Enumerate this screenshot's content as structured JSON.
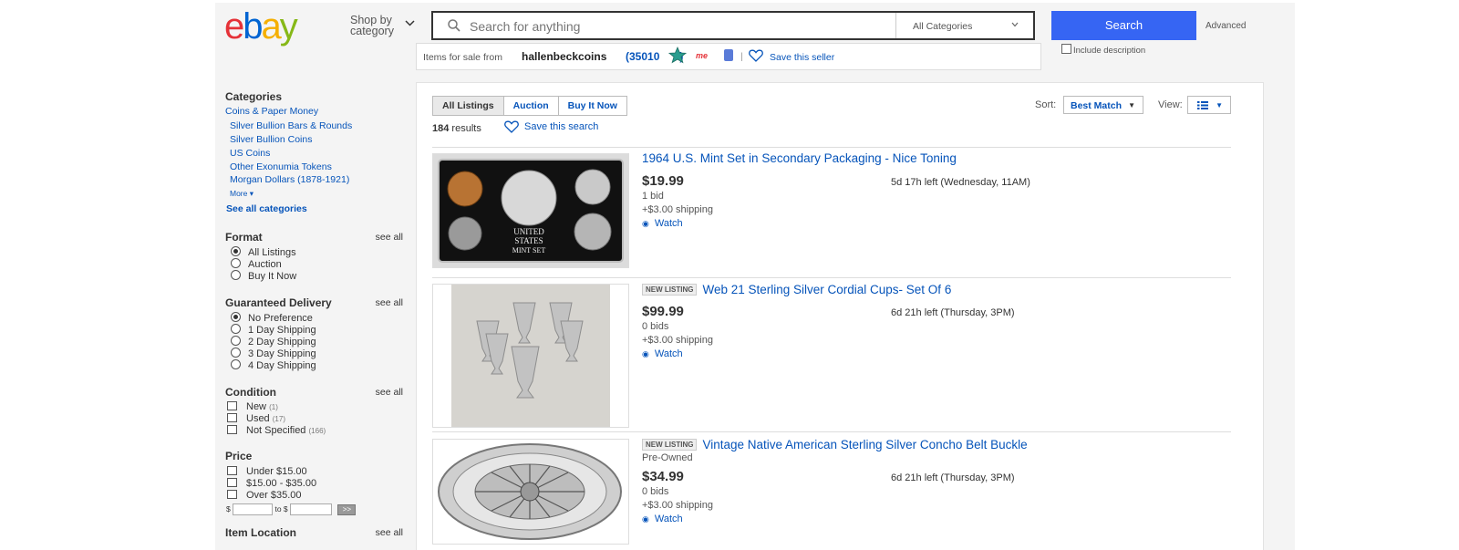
{
  "header": {
    "logo_letters": [
      "e",
      "b",
      "a",
      "y"
    ],
    "shop_by_line1": "Shop by",
    "shop_by_line2": "category",
    "search_placeholder": "Search for anything",
    "category_select": "All Categories",
    "search_button": "Search",
    "advanced_link": "Advanced",
    "include_description": "Include description",
    "brand_colors": {
      "e": "#e53238",
      "b": "#0064d2",
      "a": "#f5af02",
      "y": "#86b817"
    }
  },
  "seller": {
    "prefix": "Items for sale from",
    "name": "hallenbeckcoins",
    "feedback_open": "(",
    "feedback": "35010",
    "feedback_close": ")",
    "me_badge": "me",
    "separator": "|",
    "save_label": "Save this seller"
  },
  "sidebar": {
    "categories_title": "Categories",
    "top_category": "Coins & Paper Money",
    "subcategories": [
      "Silver Bullion Bars & Rounds",
      "Silver Bullion Coins",
      "US Coins",
      "Other Exonumia Tokens",
      "Morgan Dollars (1878-1921)"
    ],
    "more": "More",
    "see_all_categories": "See all categories",
    "see_all": "see all",
    "format": {
      "title": "Format",
      "options": [
        "All Listings",
        "Auction",
        "Buy It Now"
      ],
      "selected": "All Listings"
    },
    "delivery": {
      "title": "Guaranteed Delivery",
      "options": [
        "No Preference",
        "1 Day Shipping",
        "2 Day Shipping",
        "3 Day Shipping",
        "4 Day Shipping"
      ],
      "selected": "No Preference"
    },
    "condition": {
      "title": "Condition",
      "options": [
        {
          "label": "New",
          "count": "(1)"
        },
        {
          "label": "Used",
          "count": "(17)"
        },
        {
          "label": "Not Specified",
          "count": "(166)"
        }
      ]
    },
    "price": {
      "title": "Price",
      "options": [
        "Under $15.00",
        "$15.00 - $35.00",
        "Over $35.00"
      ],
      "dollar": "$",
      "to": "to $",
      "go": ">>"
    },
    "location_title": "Item Location"
  },
  "main": {
    "tabs": [
      "All Listings",
      "Auction",
      "Buy It Now"
    ],
    "active_tab": "All Listings",
    "result_count": "184",
    "results_word": "results",
    "save_search": "Save this search",
    "sort_label": "Sort:",
    "sort_value": "Best Match",
    "view_label": "View:",
    "new_listing_badge": "NEW LISTING",
    "items": [
      {
        "title": "1964 U.S. Mint Set in Secondary Packaging - Nice Toning",
        "new": false,
        "condition": "",
        "price": "$19.99",
        "time_left": "5d 17h left (Wednesday, 11AM)",
        "bids": "1 bid",
        "shipping": "+$3.00 shipping",
        "watch": "Watch",
        "image_text": [
          "UNITED",
          "STATES",
          "MINT SET"
        ]
      },
      {
        "title": "Web 21 Sterling Silver Cordial Cups- Set Of 6",
        "new": true,
        "condition": "",
        "price": "$99.99",
        "time_left": "6d 21h left (Thursday, 3PM)",
        "bids": "0 bids",
        "shipping": "+$3.00 shipping",
        "watch": "Watch"
      },
      {
        "title": "Vintage Native American Sterling Silver Concho Belt Buckle",
        "new": true,
        "condition": "Pre-Owned",
        "price": "$34.99",
        "time_left": "6d 21h left (Thursday, 3PM)",
        "bids": "0 bids",
        "shipping": "+$3.00 shipping",
        "watch": "Watch"
      }
    ]
  }
}
